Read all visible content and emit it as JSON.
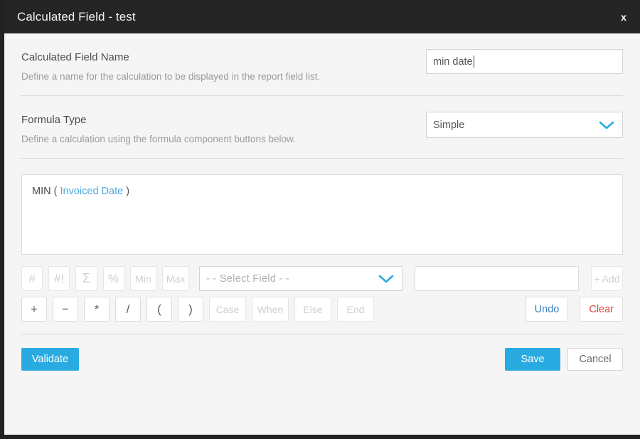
{
  "window": {
    "title": "Calculated Field - test",
    "close_label": "x"
  },
  "colors": {
    "accent_blue": "#29abe2",
    "titlebar": "#252526",
    "body_bg": "#f5f5f5",
    "field_token_blue": "#4aa8dd",
    "undo_blue": "#3e7fbf",
    "clear_red": "#e0453a"
  },
  "name_row": {
    "label": "Calculated Field Name",
    "hint": "Define a name for the calculation to be displayed in the report field list.",
    "value": "min date",
    "placeholder": ""
  },
  "formula_type_row": {
    "label": "Formula Type",
    "hint": "Define a calculation using the formula component buttons below.",
    "selected": "Simple",
    "chevron_icon": "chevron-down-icon"
  },
  "formula_editor": {
    "function": "MIN",
    "open_paren": "(",
    "field": "Invoiced Date",
    "close_paren": ")"
  },
  "keypad": {
    "row1": [
      {
        "label": "#",
        "name": "number-button",
        "disabled": true
      },
      {
        "label": "#!",
        "name": "number-distinct-button",
        "disabled": true
      },
      {
        "label": "Σ",
        "name": "sum-button",
        "disabled": true
      },
      {
        "label": "%",
        "name": "percent-button",
        "disabled": true
      },
      {
        "label": "Min",
        "name": "min-button",
        "disabled": true
      },
      {
        "label": "Max",
        "name": "max-button",
        "disabled": true
      }
    ],
    "row2": [
      {
        "label": "+",
        "name": "plus-button",
        "disabled": false
      },
      {
        "label": "−",
        "name": "minus-button",
        "disabled": false
      },
      {
        "label": "*",
        "name": "multiply-button",
        "disabled": false
      },
      {
        "label": "/",
        "name": "divide-button",
        "disabled": false
      },
      {
        "label": "(",
        "name": "open-paren-button",
        "disabled": false
      },
      {
        "label": ")",
        "name": "close-paren-button",
        "disabled": false
      },
      {
        "label": "Case",
        "name": "case-button",
        "disabled": true
      },
      {
        "label": "When",
        "name": "when-button",
        "disabled": true
      },
      {
        "label": "Else",
        "name": "else-button",
        "disabled": true
      },
      {
        "label": "End",
        "name": "end-button",
        "disabled": true
      }
    ],
    "select_field_placeholder": "- - Select Field - -",
    "value_input_value": "",
    "add_label": "+ Add",
    "undo_label": "Undo",
    "clear_label": "Clear"
  },
  "footer": {
    "validate_label": "Validate",
    "save_label": "Save",
    "cancel_label": "Cancel"
  }
}
